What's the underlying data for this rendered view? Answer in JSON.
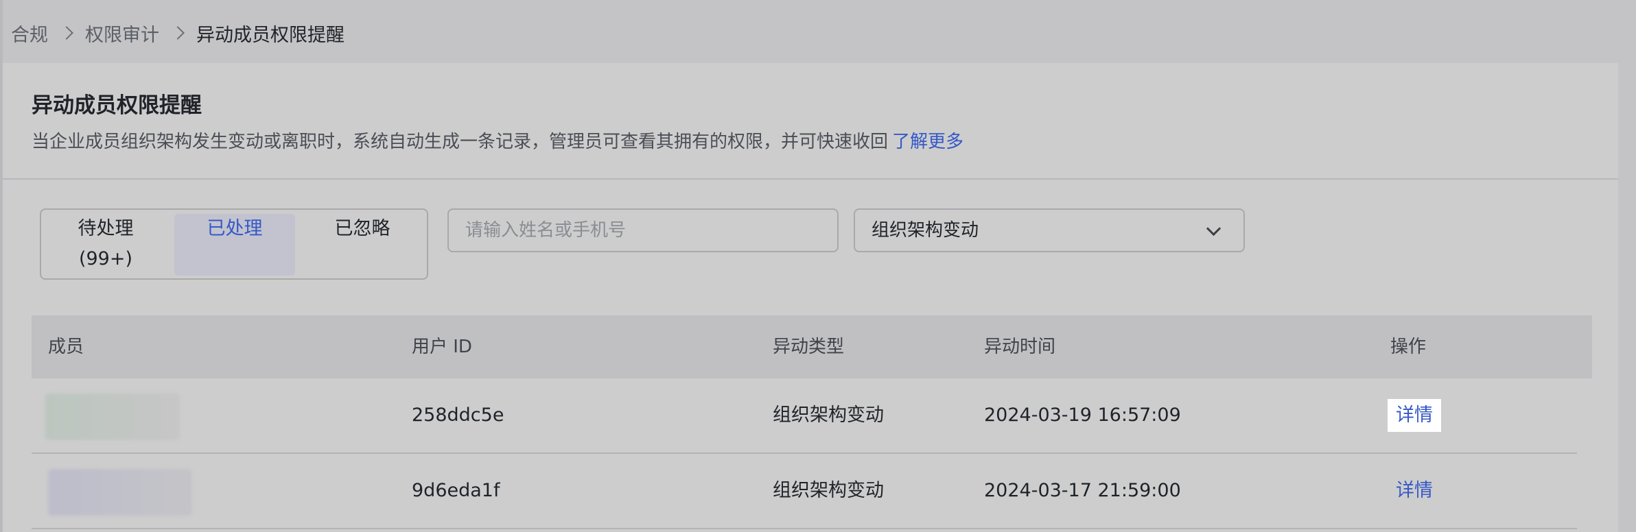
{
  "breadcrumb": {
    "items": [
      "合规",
      "权限审计",
      "异动成员权限提醒"
    ]
  },
  "header": {
    "title": "异动成员权限提醒",
    "description": "当企业成员组织架构发生变动或离职时，系统自动生成一条记录，管理员可查看其拥有的权限，并可快速收回",
    "learn_more": "了解更多"
  },
  "filters": {
    "segments": [
      {
        "label": "待处理",
        "count": "(99+)",
        "selected": false
      },
      {
        "label": "已处理",
        "count": "",
        "selected": true
      },
      {
        "label": "已忽略",
        "count": "",
        "selected": false
      }
    ],
    "search_placeholder": "请输入姓名或手机号",
    "type_select": "组织架构变动"
  },
  "table": {
    "columns": [
      "成员",
      "用户 ID",
      "异动类型",
      "异动时间",
      "操作"
    ],
    "rows": [
      {
        "user_id": "258ddc5e",
        "type": "组织架构变动",
        "time": "2024-03-19 16:57:09",
        "action": "详情"
      },
      {
        "user_id": "9d6eda1f",
        "type": "组织架构变动",
        "time": "2024-03-17 21:59:00",
        "action": "详情"
      }
    ]
  },
  "colors": {
    "accent": "#3558c7",
    "background": "#c4c4c6",
    "card": "#cdcdcd"
  }
}
